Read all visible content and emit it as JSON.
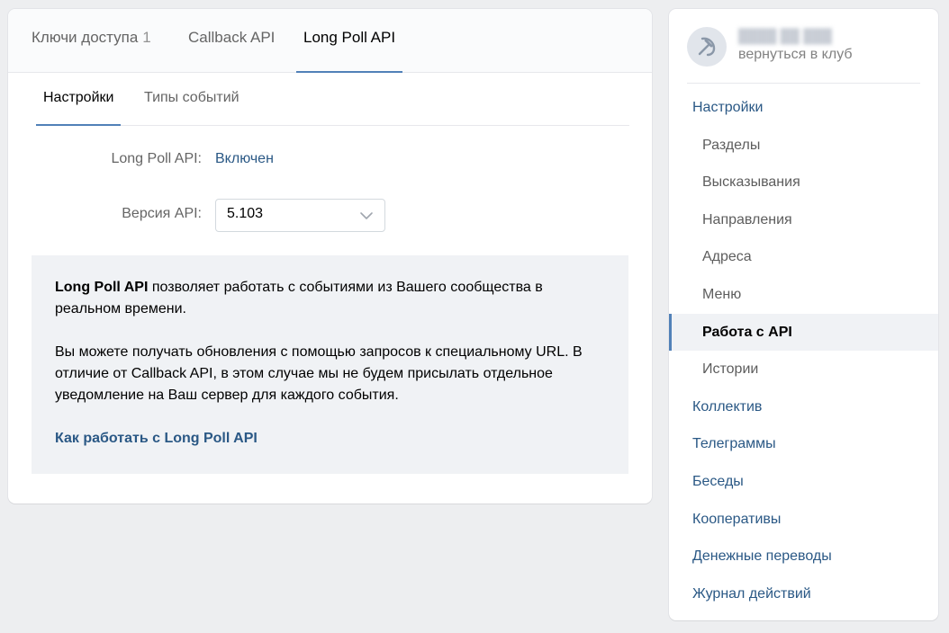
{
  "top_tabs": [
    {
      "label": "Ключи доступа",
      "count": "1"
    },
    {
      "label": "Callback API"
    },
    {
      "label": "Long Poll API"
    }
  ],
  "sub_tabs": [
    {
      "label": "Настройки"
    },
    {
      "label": "Типы событий"
    }
  ],
  "settings": {
    "longpoll_label": "Long Poll API:",
    "longpoll_value": "Включен",
    "version_label": "Версия API:",
    "version_value": "5.103"
  },
  "info": {
    "p1_bold": "Long Poll API",
    "p1_rest": " позволяет работать с событиями из Вашего сообщества в реальном времени.",
    "p2": "Вы можете получать обновления с помощью запросов к специальному URL. В отличие от Callback API, в этом случае мы не будем присылать отдельное уведомление на Ваш сервер для каждого события.",
    "link": "Как работать с Long Poll API"
  },
  "sidebar": {
    "club_name": "████ ██ ███",
    "back_label": "вернуться в клуб",
    "items": [
      {
        "label": "Настройки"
      },
      {
        "label": "Разделы"
      },
      {
        "label": "Высказывания"
      },
      {
        "label": "Направления"
      },
      {
        "label": "Адреса"
      },
      {
        "label": "Меню"
      },
      {
        "label": "Работа с API"
      },
      {
        "label": "Истории"
      },
      {
        "label": "Коллектив"
      },
      {
        "label": "Телеграммы"
      },
      {
        "label": "Беседы"
      },
      {
        "label": "Кооперативы"
      },
      {
        "label": "Денежные переводы"
      },
      {
        "label": "Журнал действий"
      }
    ]
  },
  "colors": {
    "accent": "#5181b8",
    "link": "#2a5885",
    "background": "#edeef0"
  },
  "icons": {
    "avatar": "hammer-and-sickle-icon",
    "select": "chevron-down-icon"
  }
}
